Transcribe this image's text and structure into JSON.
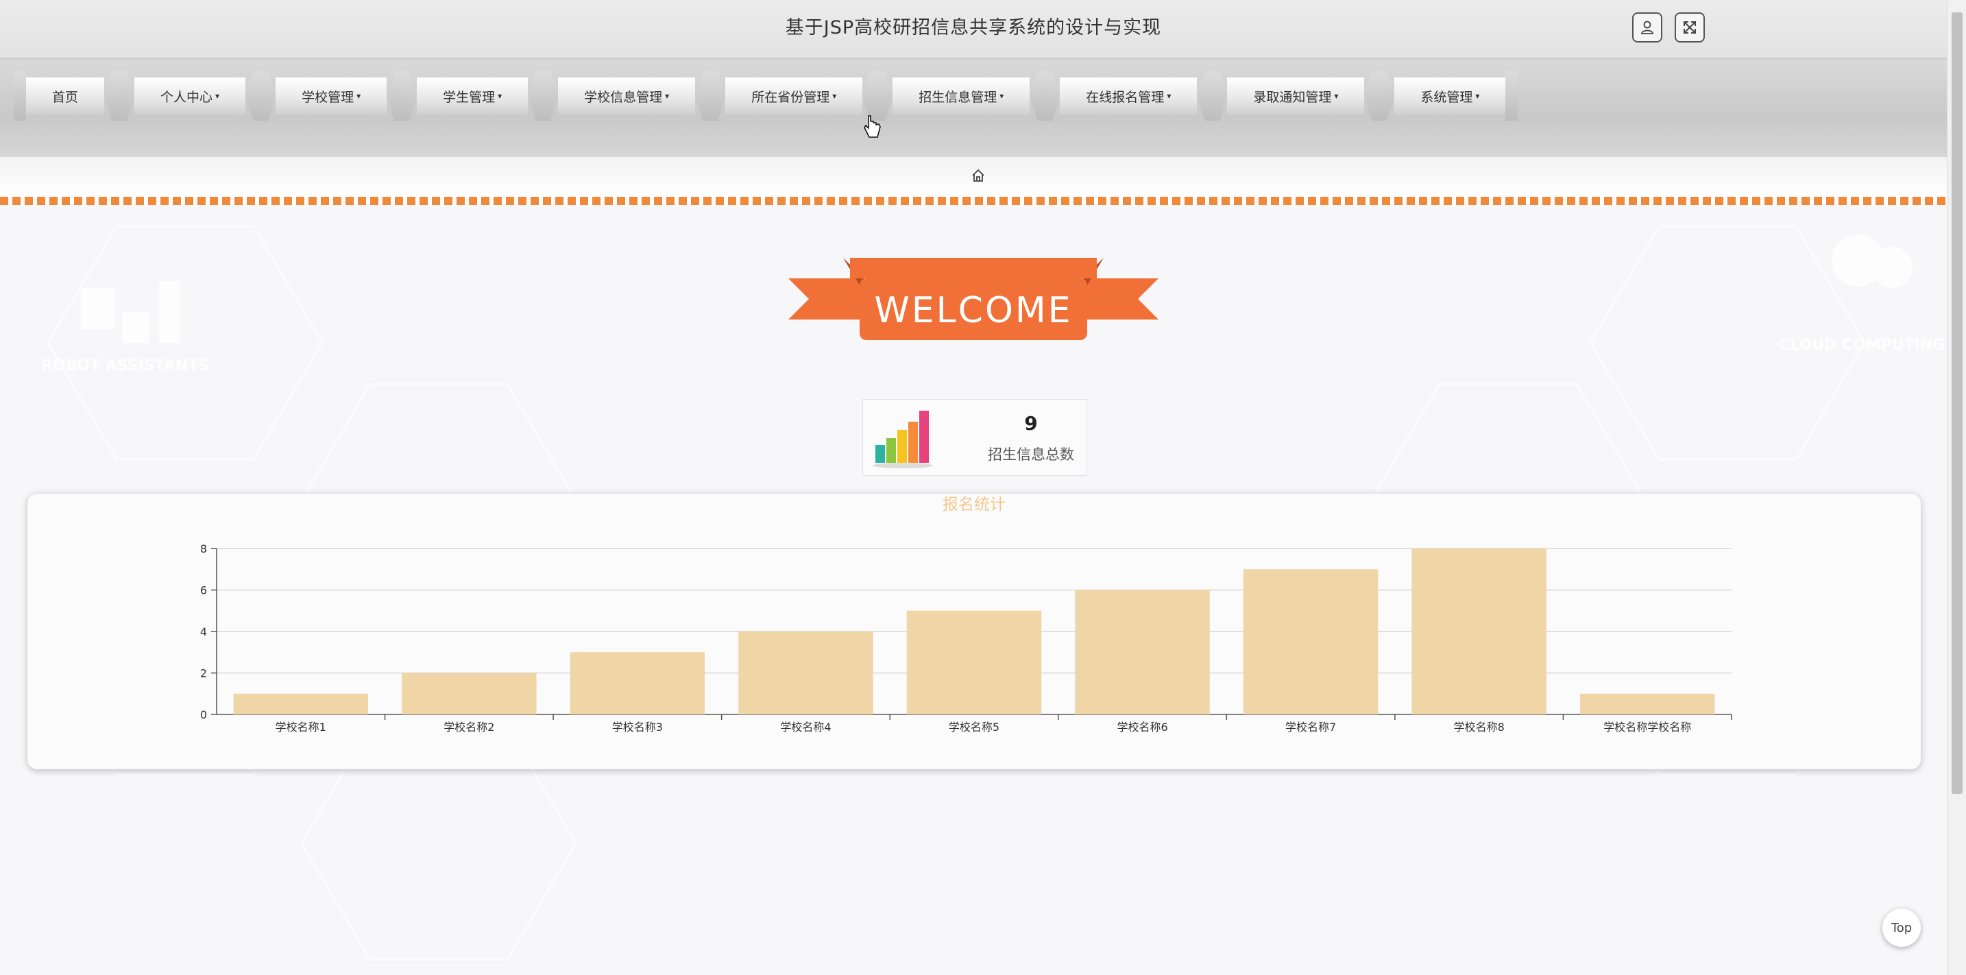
{
  "header": {
    "site_title": "基于JSP高校研招信息共享系统的设计与实现",
    "user_icon": "user-icon",
    "fullscreen_icon": "fullscreen-icon"
  },
  "nav": {
    "items": [
      {
        "label": "首页",
        "dropdown": false
      },
      {
        "label": "个人中心",
        "dropdown": true
      },
      {
        "label": "学校管理",
        "dropdown": true
      },
      {
        "label": "学生管理",
        "dropdown": true
      },
      {
        "label": "学校信息管理",
        "dropdown": true
      },
      {
        "label": "所在省份管理",
        "dropdown": true
      },
      {
        "label": "招生信息管理",
        "dropdown": true
      },
      {
        "label": "在线报名管理",
        "dropdown": true
      },
      {
        "label": "录取通知管理",
        "dropdown": true
      },
      {
        "label": "系统管理",
        "dropdown": true
      }
    ],
    "caret": "▾"
  },
  "breadcrumb": {
    "home_icon": "home-icon"
  },
  "welcome": {
    "text": "WELCOME",
    "ribbon_color": "#f07038"
  },
  "stats": {
    "value": "9",
    "label": "招生信息总数"
  },
  "chart_data": {
    "type": "bar",
    "title": "报名统计",
    "categories": [
      "学校名称1",
      "学校名称2",
      "学校名称3",
      "学校名称4",
      "学校名称5",
      "学校名称6",
      "学校名称7",
      "学校名称8",
      "学校名称学校名称"
    ],
    "values": [
      1,
      2,
      3,
      4,
      5,
      6,
      7,
      8,
      1
    ],
    "ylim": [
      0,
      8
    ],
    "yticks": [
      0,
      2,
      4,
      6,
      8
    ],
    "bar_color": "#f0d5a6",
    "grid": true
  },
  "scroll": {
    "top_label": "Top"
  },
  "colors": {
    "accent": "#f08a3a",
    "ribbon": "#f07038"
  }
}
